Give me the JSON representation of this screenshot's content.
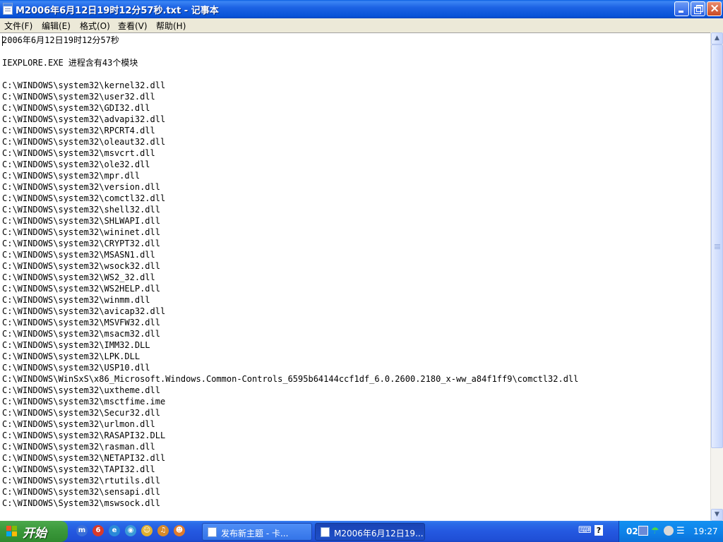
{
  "window": {
    "title": "M2006年6月12日19时12分57秒.txt - 记事本",
    "buttons": {
      "minimize": "minimize",
      "maximize": "maximize",
      "close": "×"
    }
  },
  "menu": {
    "items": [
      "文件(F)",
      "编辑(E)",
      "格式(O)",
      "查看(V)",
      "帮助(H)"
    ]
  },
  "document": {
    "lines": [
      "2006年6月12日19时12分57秒",
      "",
      "IEXPLORE.EXE 进程含有43个模块",
      "",
      "C:\\WINDOWS\\system32\\kernel32.dll",
      "C:\\WINDOWS\\system32\\user32.dll",
      "C:\\WINDOWS\\system32\\GDI32.dll",
      "C:\\WINDOWS\\system32\\advapi32.dll",
      "C:\\WINDOWS\\system32\\RPCRT4.dll",
      "C:\\WINDOWS\\system32\\oleaut32.dll",
      "C:\\WINDOWS\\system32\\msvcrt.dll",
      "C:\\WINDOWS\\system32\\ole32.dll",
      "C:\\WINDOWS\\system32\\mpr.dll",
      "C:\\WINDOWS\\system32\\version.dll",
      "C:\\WINDOWS\\system32\\comctl32.dll",
      "C:\\WINDOWS\\system32\\shell32.dll",
      "C:\\WINDOWS\\system32\\SHLWAPI.dll",
      "C:\\WINDOWS\\system32\\wininet.dll",
      "C:\\WINDOWS\\system32\\CRYPT32.dll",
      "C:\\WINDOWS\\system32\\MSASN1.dll",
      "C:\\WINDOWS\\system32\\wsock32.dll",
      "C:\\WINDOWS\\system32\\WS2_32.dll",
      "C:\\WINDOWS\\system32\\WS2HELP.dll",
      "C:\\WINDOWS\\system32\\winmm.dll",
      "C:\\WINDOWS\\system32\\avicap32.dll",
      "C:\\WINDOWS\\system32\\MSVFW32.dll",
      "C:\\WINDOWS\\system32\\msacm32.dll",
      "C:\\WINDOWS\\system32\\IMM32.DLL",
      "C:\\WINDOWS\\system32\\LPK.DLL",
      "C:\\WINDOWS\\system32\\USP10.dll",
      "C:\\WINDOWS\\WinSxS\\x86_Microsoft.Windows.Common-Controls_6595b64144ccf1df_6.0.2600.2180_x-ww_a84f1ff9\\comctl32.dll",
      "C:\\WINDOWS\\system32\\uxtheme.dll",
      "C:\\WINDOWS\\system32\\msctfime.ime",
      "C:\\WINDOWS\\system32\\Secur32.dll",
      "C:\\WINDOWS\\system32\\urlmon.dll",
      "C:\\WINDOWS\\system32\\RASAPI32.DLL",
      "C:\\WINDOWS\\system32\\rasman.dll",
      "C:\\WINDOWS\\system32\\NETAPI32.dll",
      "C:\\WINDOWS\\system32\\TAPI32.dll",
      "C:\\WINDOWS\\system32\\rtutils.dll",
      "C:\\WINDOWS\\system32\\sensapi.dll",
      "C:\\WINDOWS\\System32\\mswsock.dll"
    ]
  },
  "scrollbar": {
    "up_glyph": "▲",
    "down_glyph": "▼"
  },
  "taskbar": {
    "start_label": "开始",
    "quick_launch": [
      {
        "icon": "maxthon-icon",
        "glyph": "m",
        "color": "#3a6fd8"
      },
      {
        "icon": "weibo-icon",
        "glyph": "6",
        "color": "#d83a2a"
      },
      {
        "icon": "internet-explorer-icon",
        "glyph": "e",
        "color": "#2a8ad8"
      },
      {
        "icon": "explorer-icon",
        "glyph": "◉",
        "color": "#3a9ad8"
      },
      {
        "icon": "qq-icon",
        "glyph": "☺",
        "color": "#e0b030"
      },
      {
        "icon": "media-icon",
        "glyph": "♫",
        "color": "#d88a2a"
      },
      {
        "icon": "messenger-icon",
        "glyph": "☻",
        "color": "#e07a2a"
      }
    ],
    "tasks": [
      {
        "label": "发布新主题 - 卡...",
        "icon": "ie-window-icon"
      },
      {
        "label": "M2006年6月12日19...",
        "icon": "notepad-icon"
      }
    ],
    "language_bar": {
      "keyboard_glyph": "⌨",
      "help_glyph": "?"
    },
    "tray": {
      "prefix": "02",
      "clock": "19:27"
    }
  }
}
